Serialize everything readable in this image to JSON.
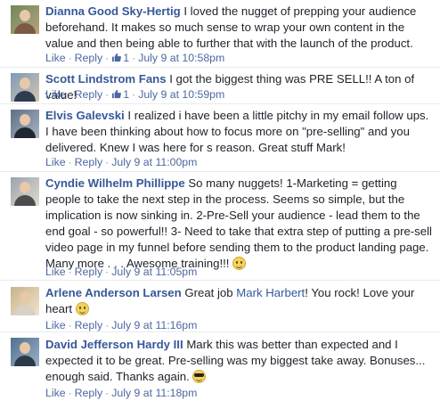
{
  "actions": {
    "like": "Like",
    "reply": "Reply",
    "separator": "·"
  },
  "comments": [
    {
      "author": "Dianna Good Sky-Hertig",
      "text": "I loved the nugget of prepping your audience beforehand. It makes so much sense to wrap your own content in the value and then being able to further that with the launch of the product.",
      "likes": "1",
      "timestamp": "July 9 at 10:58pm"
    },
    {
      "author": "Scott Lindstrom Fans",
      "text": "I got the biggest thing was PRE SELL!! A ton of value!",
      "likes": "1",
      "timestamp": "July 9 at 10:59pm"
    },
    {
      "author": "Elvis Galevski",
      "text": "I realized i have been a little pitchy in my email follow ups. I have been thinking about how to focus more on \"pre-selling\" and you delivered. Knew I was here for s reason. Great stuff Mark!",
      "timestamp": "July 9 at 11:00pm"
    },
    {
      "author": "Cyndie Wilhelm Phillippe",
      "text": "So many nuggets! 1-Marketing = getting people to take the next step in the process. Seems so simple, but the implication is now sinking in. 2-Pre-Sell your audience - lead them to the end goal - so powerful!! 3- Need to take that extra step of putting a pre-sell video page in my funnel before sending them to the product landing page. Many more . . . Awesome training!!!",
      "emoji": "smile-emoji",
      "timestamp": "July 9 at 11:05pm"
    },
    {
      "author": "Arlene Anderson Larsen",
      "text_before": "Great job",
      "mention": "Mark Harbert",
      "text_after": "! You rock! Love your heart",
      "emoji": "smile-emoji",
      "timestamp": "July 9 at 11:16pm"
    },
    {
      "author": "David Jefferson Hardy III",
      "text": "Mark this was better than expected and I expected it to be great. Pre-selling was my biggest take away. Bonuses... enough said. Thanks again.",
      "emoji": "sunglasses-emoji",
      "timestamp": "July 9 at 11:18pm"
    }
  ],
  "colors": {
    "author": "#365899",
    "link": "#4b67a1",
    "meta": "#90949c",
    "text": "#1d2129"
  }
}
